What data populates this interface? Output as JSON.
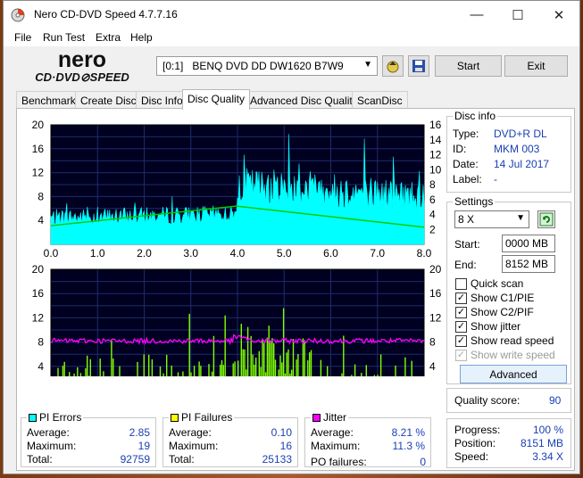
{
  "window": {
    "title": "Nero CD-DVD Speed 4.7.7.16"
  },
  "menu": [
    "File",
    "Run Test",
    "Extra",
    "Help"
  ],
  "logo": {
    "line1": "nero",
    "line2": "CD·DVD⊘SPEED"
  },
  "drive": {
    "selected": "[0:1]   BENQ DVD DD DW1620 B7W9"
  },
  "toolbar": {
    "start": "Start",
    "exit": "Exit"
  },
  "tabs": [
    "Benchmark",
    "Create Disc",
    "Disc Info",
    "Disc Quality",
    "Advanced Disc Quality",
    "ScanDisc"
  ],
  "active_tab": "Disc Quality",
  "disc_info": {
    "title": "Disc info",
    "type_label": "Type:",
    "type": "DVD+R DL",
    "id_label": "ID:",
    "id": "MKM 003",
    "date_label": "Date:",
    "date": "14 Jul 2017",
    "label_label": "Label:",
    "label": "-"
  },
  "settings": {
    "title": "Settings",
    "speed": "8 X",
    "start_label": "Start:",
    "start": "0000 MB",
    "end_label": "End:",
    "end": "8152 MB",
    "quick_scan": "Quick scan",
    "show_c1": "Show C1/PIE",
    "show_c2": "Show C2/PIF",
    "show_jitter": "Show jitter",
    "show_read": "Show read speed",
    "show_write": "Show write speed",
    "advanced": "Advanced"
  },
  "quality": {
    "label": "Quality score:",
    "value": "90"
  },
  "progress": {
    "progress_label": "Progress:",
    "progress": "100 %",
    "position_label": "Position:",
    "position": "8151 MB",
    "speed_label": "Speed:",
    "speed": "3.34 X"
  },
  "pi_errors": {
    "title": "PI Errors",
    "avg_label": "Average:",
    "avg": "2.85",
    "max_label": "Maximum:",
    "max": "19",
    "total_label": "Total:",
    "total": "92759"
  },
  "pi_failures": {
    "title": "PI Failures",
    "avg_label": "Average:",
    "avg": "0.10",
    "max_label": "Maximum:",
    "max": "16",
    "total_label": "Total:",
    "total": "25133"
  },
  "jitter": {
    "title": "Jitter",
    "avg_label": "Average:",
    "avg": "8.21 %",
    "max_label": "Maximum:",
    "max": "11.3 %",
    "po_label": "PO failures:",
    "po": "0"
  },
  "colors": {
    "pie": "#00ffff",
    "pif": "#80ff00",
    "jitter": "#ff00ff",
    "speed": "#00cc00",
    "plot_bg": "#000020",
    "grid": "#1e2c6c"
  },
  "chart_data": [
    {
      "type": "area",
      "x": [
        0.0,
        4.0,
        8.0
      ],
      "x_ticks": [
        "0.0",
        "1.0",
        "2.0",
        "3.0",
        "4.0",
        "5.0",
        "6.0",
        "7.0",
        "8.0"
      ],
      "y_left_ticks": [
        "20",
        "16",
        "12",
        "8",
        "4"
      ],
      "y_right_ticks": [
        "16",
        "14",
        "12",
        "10",
        "8",
        "6",
        "4",
        "2"
      ],
      "xlim": [
        0,
        8
      ],
      "ylim_left": [
        0,
        20
      ],
      "ylim_right": [
        0,
        16
      ],
      "series": [
        {
          "name": "PI Errors",
          "approx_baseline": [
            2.5,
            7,
            5
          ],
          "max": 19
        },
        {
          "name": "Read speed",
          "x": [
            0.0,
            3.95,
            4.0,
            8.0
          ],
          "y": [
            2.5,
            5.1,
            5.1,
            2.3
          ]
        }
      ]
    },
    {
      "type": "area",
      "x_ticks": [
        "0.0",
        "1.0",
        "2.0",
        "3.0",
        "4.0",
        "5.0",
        "6.0",
        "7.0",
        "8.0"
      ],
      "y_left_ticks": [
        "20",
        "16",
        "12",
        "8",
        "4"
      ],
      "y_right_ticks": [
        "20",
        "16",
        "12",
        "8",
        "4"
      ],
      "xlim": [
        0,
        8
      ],
      "ylim": [
        0,
        20
      ],
      "series": [
        {
          "name": "PI Failures",
          "max": 16
        },
        {
          "name": "Jitter",
          "approx_level": 8.2
        }
      ]
    }
  ]
}
